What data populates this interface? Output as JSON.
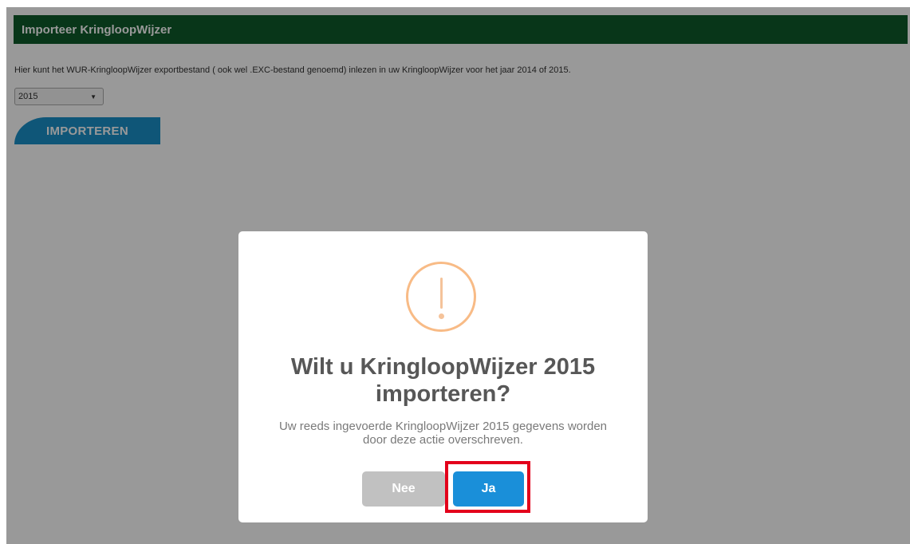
{
  "header": {
    "title": "Importeer KringloopWijzer"
  },
  "main": {
    "description": "Hier kunt het WUR-KringloopWijzer exportbestand ( ook wel .EXC-bestand genoemd) inlezen in uw KringloopWijzer voor het jaar 2014 of 2015.",
    "year_select": {
      "value": "2015",
      "arrow_icon": "▼"
    },
    "import_button_label": "IMPORTEREN"
  },
  "modal": {
    "icon": "warning-icon",
    "title_line1": "Wilt u KringloopWijzer 2015",
    "title_line2": "importeren?",
    "text_line1": "Uw reeds ingevoerde KringloopWijzer 2015 gegevens worden",
    "text_line2": "door deze actie overschreven.",
    "cancel_label": "Nee",
    "confirm_label": "Ja"
  },
  "colors": {
    "header_bg": "#0e5a2b",
    "accent_blue": "#1a8fd9",
    "warning_orange": "#f8bb86",
    "highlight_red": "#e3001b"
  }
}
